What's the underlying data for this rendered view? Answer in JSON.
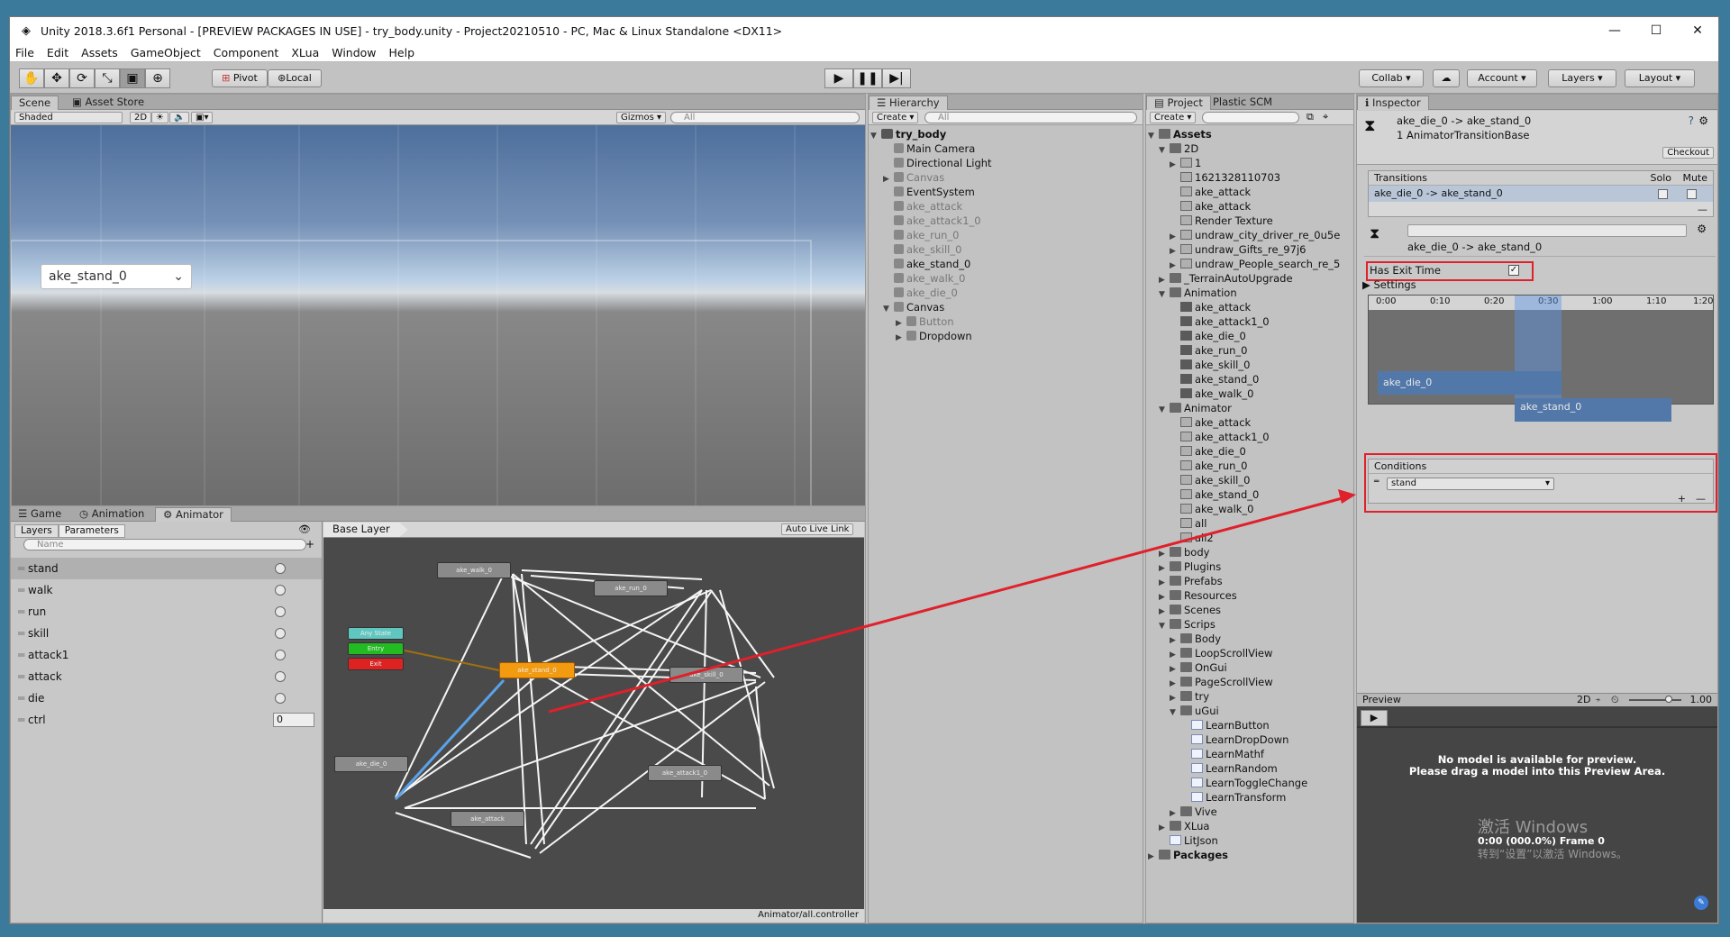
{
  "titlebar": {
    "title": "Unity 2018.3.6f1 Personal - [PREVIEW PACKAGES IN USE] - try_body.unity - Project20210510 - PC, Mac & Linux Standalone <DX11>",
    "minimize": "—",
    "maximize": "☐",
    "close": "✕"
  },
  "menu": [
    "File",
    "Edit",
    "Assets",
    "GameObject",
    "Component",
    "XLua",
    "Window",
    "Help"
  ],
  "toolbar": {
    "pivot": "Pivot",
    "local": "Local",
    "collab": "Collab ▾",
    "account": "Account",
    "layers": "Layers",
    "layout": "Layout"
  },
  "scene": {
    "tab": "Scene",
    "tab2": "Asset Store",
    "shaded": "Shaded",
    "mode2d": "2D",
    "gizmos": "Gizmos",
    "search": "All",
    "dropdown_value": "ake_stand_0"
  },
  "bottomtabs": {
    "game": "Game",
    "animation": "Animation",
    "animator": "Animator"
  },
  "animator": {
    "layers_tab": "Layers",
    "params_tab": "Parameters",
    "name_placeholder": "Name",
    "base_layer": "Base Layer",
    "auto_live": "Auto Live Link",
    "footer": "Animator/all.controller",
    "params": [
      "stand",
      "walk",
      "run",
      "skill",
      "attack1",
      "attack",
      "die",
      "ctrl"
    ],
    "ctrl_value": "0",
    "nodes": {
      "walk": "ake_walk_0",
      "run": "ake_run_0",
      "stand": "ake_stand_0",
      "skill": "ake_skill_0",
      "die": "ake_die_0",
      "attack1": "ake_attack1_0",
      "attack": "ake_attack",
      "any": "Any State",
      "entry": "Entry",
      "exit": "Exit"
    }
  },
  "hierarchy": {
    "tab": "Hierarchy",
    "create": "Create",
    "search": "All",
    "root": "try_body",
    "items": [
      {
        "t": "Main Camera",
        "d": 1,
        "g": false
      },
      {
        "t": "Directional Light",
        "d": 1,
        "g": false
      },
      {
        "t": "Canvas",
        "d": 1,
        "g": true,
        "a": "▶"
      },
      {
        "t": "EventSystem",
        "d": 1,
        "g": false
      },
      {
        "t": "ake_attack",
        "d": 1,
        "g": true
      },
      {
        "t": "ake_attack1_0",
        "d": 1,
        "g": true
      },
      {
        "t": "ake_run_0",
        "d": 1,
        "g": true
      },
      {
        "t": "ake_skill_0",
        "d": 1,
        "g": true
      },
      {
        "t": "ake_stand_0",
        "d": 1,
        "g": false
      },
      {
        "t": "ake_walk_0",
        "d": 1,
        "g": true
      },
      {
        "t": "ake_die_0",
        "d": 1,
        "g": true
      },
      {
        "t": "Canvas",
        "d": 1,
        "g": false,
        "a": "▼"
      },
      {
        "t": "Button",
        "d": 2,
        "g": true,
        "a": "▶"
      },
      {
        "t": "Dropdown",
        "d": 2,
        "g": false,
        "a": "▶"
      }
    ]
  },
  "project": {
    "tab": "Project",
    "tab2": "Plastic SCM",
    "create": "Create",
    "items": [
      {
        "t": "Assets",
        "d": 0,
        "a": "▼",
        "i": "fold",
        "b": true
      },
      {
        "t": "2D",
        "d": 1,
        "a": "▼",
        "i": "fold"
      },
      {
        "t": "1",
        "d": 2,
        "a": "▶",
        "i": "img"
      },
      {
        "t": "1621328110703",
        "d": 2,
        "a": "",
        "i": "img"
      },
      {
        "t": "ake_attack",
        "d": 2,
        "a": "",
        "i": "ctl"
      },
      {
        "t": "ake_attack",
        "d": 2,
        "a": "",
        "i": "img"
      },
      {
        "t": "Render Texture",
        "d": 2,
        "a": "",
        "i": "img"
      },
      {
        "t": "undraw_city_driver_re_0u5e",
        "d": 2,
        "a": "▶",
        "i": "img"
      },
      {
        "t": "undraw_Gifts_re_97j6",
        "d": 2,
        "a": "▶",
        "i": "img"
      },
      {
        "t": "undraw_People_search_re_5",
        "d": 2,
        "a": "▶",
        "i": "img"
      },
      {
        "t": "_TerrainAutoUpgrade",
        "d": 1,
        "a": "▶",
        "i": "fold"
      },
      {
        "t": "Animation",
        "d": 1,
        "a": "▼",
        "i": "fold"
      },
      {
        "t": "ake_attack",
        "d": 2,
        "a": "",
        "i": "anim"
      },
      {
        "t": "ake_attack1_0",
        "d": 2,
        "a": "",
        "i": "anim"
      },
      {
        "t": "ake_die_0",
        "d": 2,
        "a": "",
        "i": "anim"
      },
      {
        "t": "ake_run_0",
        "d": 2,
        "a": "",
        "i": "anim"
      },
      {
        "t": "ake_skill_0",
        "d": 2,
        "a": "",
        "i": "anim"
      },
      {
        "t": "ake_stand_0",
        "d": 2,
        "a": "",
        "i": "anim"
      },
      {
        "t": "ake_walk_0",
        "d": 2,
        "a": "",
        "i": "anim"
      },
      {
        "t": "Animator",
        "d": 1,
        "a": "▼",
        "i": "fold"
      },
      {
        "t": "ake_attack",
        "d": 2,
        "a": "",
        "i": "ctl"
      },
      {
        "t": "ake_attack1_0",
        "d": 2,
        "a": "",
        "i": "ctl"
      },
      {
        "t": "ake_die_0",
        "d": 2,
        "a": "",
        "i": "ctl"
      },
      {
        "t": "ake_run_0",
        "d": 2,
        "a": "",
        "i": "ctl"
      },
      {
        "t": "ake_skill_0",
        "d": 2,
        "a": "",
        "i": "ctl"
      },
      {
        "t": "ake_stand_0",
        "d": 2,
        "a": "",
        "i": "ctl"
      },
      {
        "t": "ake_walk_0",
        "d": 2,
        "a": "",
        "i": "ctl"
      },
      {
        "t": "all",
        "d": 2,
        "a": "",
        "i": "ctl"
      },
      {
        "t": "all2",
        "d": 2,
        "a": "",
        "i": "ctl"
      },
      {
        "t": "body",
        "d": 1,
        "a": "▶",
        "i": "fold"
      },
      {
        "t": "Plugins",
        "d": 1,
        "a": "▶",
        "i": "fold"
      },
      {
        "t": "Prefabs",
        "d": 1,
        "a": "▶",
        "i": "fold"
      },
      {
        "t": "Resources",
        "d": 1,
        "a": "▶",
        "i": "fold"
      },
      {
        "t": "Scenes",
        "d": 1,
        "a": "▶",
        "i": "fold"
      },
      {
        "t": "Scrips",
        "d": 1,
        "a": "▼",
        "i": "fold"
      },
      {
        "t": "Body",
        "d": 2,
        "a": "▶",
        "i": "fold"
      },
      {
        "t": "LoopScrollView",
        "d": 2,
        "a": "▶",
        "i": "fold"
      },
      {
        "t": "OnGui",
        "d": 2,
        "a": "▶",
        "i": "fold"
      },
      {
        "t": "PageScrollView",
        "d": 2,
        "a": "▶",
        "i": "fold"
      },
      {
        "t": "try",
        "d": 2,
        "a": "▶",
        "i": "fold"
      },
      {
        "t": "uGui",
        "d": 2,
        "a": "▼",
        "i": "fold"
      },
      {
        "t": "LearnButton",
        "d": 3,
        "a": "",
        "i": "scr"
      },
      {
        "t": "LearnDropDown",
        "d": 3,
        "a": "",
        "i": "scr"
      },
      {
        "t": "LearnMathf",
        "d": 3,
        "a": "",
        "i": "scr"
      },
      {
        "t": "LearnRandom",
        "d": 3,
        "a": "",
        "i": "scr"
      },
      {
        "t": "LearnToggleChange",
        "d": 3,
        "a": "",
        "i": "scr"
      },
      {
        "t": "LearnTransform",
        "d": 3,
        "a": "",
        "i": "scr"
      },
      {
        "t": "Vive",
        "d": 2,
        "a": "▶",
        "i": "fold"
      },
      {
        "t": "XLua",
        "d": 1,
        "a": "▶",
        "i": "fold"
      },
      {
        "t": "LitJson",
        "d": 1,
        "a": "",
        "i": "scr"
      },
      {
        "t": "Packages",
        "d": 0,
        "a": "▶",
        "i": "fold",
        "b": true
      }
    ]
  },
  "inspector": {
    "tab": "Inspector",
    "title": "ake_die_0 -> ake_stand_0",
    "subtitle": "1 AnimatorTransitionBase",
    "checkout": "Checkout",
    "transitions": "Transitions",
    "solo": "Solo",
    "mute": "Mute",
    "transition_row": "ake_die_0 -> ake_stand_0",
    "detail_name": "ake_die_0 -> ake_stand_0",
    "has_exit": "Has Exit Time",
    "settings": "Settings",
    "ticks": [
      "0:00",
      "0:10",
      "0:20",
      "0:30",
      "1:00",
      "1:10",
      "1:20"
    ],
    "clip_a": "ake_die_0",
    "clip_b": "ake_stand_0",
    "conditions": "Conditions",
    "condition_param": "stand",
    "plus": "+",
    "minus": "—"
  },
  "preview": {
    "label": "Preview",
    "mode2d": "2D",
    "speed": "1.00",
    "msg1": "No model is available for preview.",
    "msg2": "Please drag a model into this Preview Area.",
    "time": "0:00 (000.0%) Frame 0",
    "watermark1": "激活 Windows",
    "watermark2": "转到“设置”以激活 Windows。"
  },
  "accent": "#e0202a"
}
